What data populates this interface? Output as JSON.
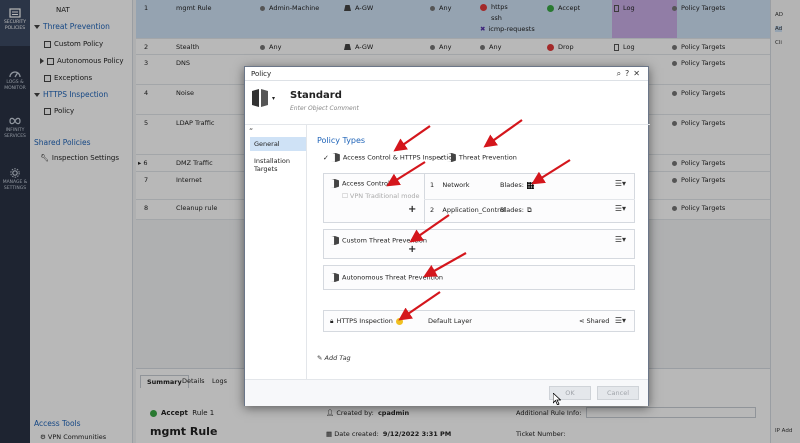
{
  "rail": [
    {
      "label": "SECURITY POLICIES",
      "icon": "security-policies-icon",
      "active": true
    },
    {
      "label": "LOGS & MONITOR",
      "icon": "logs-monitor-icon"
    },
    {
      "label": "INFINITY SERVICES",
      "icon": "infinity-icon"
    },
    {
      "label": "MANAGE & SETTINGS",
      "icon": "manage-settings-icon"
    }
  ],
  "nav": {
    "nat": "NAT",
    "threat_prevention": "Threat Prevention",
    "custom_policy": "Custom Policy",
    "autonomous_policy": "Autonomous Policy",
    "exceptions": "Exceptions",
    "https_inspection": "HTTPS Inspection",
    "policy": "Policy",
    "shared_policies": "Shared Policies",
    "inspection_settings": "Inspection Settings"
  },
  "rules": [
    {
      "no": "1",
      "name": "mgmt Rule",
      "source": "Admin-Machine",
      "dest": "A-GW",
      "vpn": "Any",
      "services": [
        "https",
        "ssh",
        "icmp-requests"
      ],
      "action": "Accept",
      "track": "Log",
      "install": "Policy Targets"
    },
    {
      "no": "2",
      "name": "Stealth",
      "source": "Any",
      "dest": "A-GW",
      "vpn": "Any",
      "services": [
        "Any"
      ],
      "action": "Drop",
      "track": "Log",
      "install": "Policy Targets"
    },
    {
      "no": "3",
      "name": "DNS",
      "source": "",
      "dest": "",
      "vpn": "",
      "services": [],
      "action": "",
      "track": "",
      "install": "Policy Targets"
    },
    {
      "no": "4",
      "name": "Noise",
      "source": "",
      "dest": "",
      "vpn": "",
      "services": [],
      "action": "",
      "track": "",
      "install": "Policy Targets"
    },
    {
      "no": "5",
      "name": "LDAP Traffic",
      "source": "",
      "dest": "",
      "vpn": "",
      "services": [],
      "action": "",
      "track": "",
      "install": "Policy Targets"
    },
    {
      "no": "6",
      "name": "DMZ Traffic",
      "source": "",
      "dest": "",
      "vpn": "",
      "services": [],
      "action": "",
      "track": "",
      "install": "Policy Targets"
    },
    {
      "no": "7",
      "name": "Internet",
      "source": "",
      "dest": "",
      "vpn": "",
      "services": [],
      "action": "",
      "track": "",
      "install": "Policy Targets"
    },
    {
      "no": "8",
      "name": "Cleanup rule",
      "source": "",
      "dest": "",
      "vpn": "",
      "services": [],
      "action": "",
      "track": "",
      "install": "Policy Targets"
    }
  ],
  "right_panel": [
    "AD",
    "Ad",
    "Cli"
  ],
  "bottom": {
    "tabs": [
      "Summary",
      "Details",
      "Logs"
    ],
    "action": "Accept",
    "rule_no": "Rule 1",
    "rule_name": "mgmt Rule",
    "created_by_label": "Created by:",
    "created_by": "cpadmin",
    "date_created_label": "Date created:",
    "date_created": "9/12/2022 3:31 PM",
    "additional_info_label": "Additional Rule Info:",
    "ticket_label": "Ticket Number:",
    "ip_label": "IP Add"
  },
  "access_tools": "Access Tools",
  "vpn_communities": "VPN Communities",
  "dialog": {
    "title": "Policy",
    "name": "Standard",
    "comment_placeholder": "Enter Object Comment",
    "side_items": [
      "General",
      "Installation Targets"
    ],
    "policy_types_label": "Policy Types",
    "access_control_https": "Access Control & HTTPS Inspection",
    "threat_prevention": "Threat Prevention",
    "access_control": "Access Control",
    "vpn_traditional": "VPN Traditional mode",
    "layers": [
      {
        "no": "1",
        "name": "Network",
        "blades": "Blades:"
      },
      {
        "no": "2",
        "name": "Application_Control",
        "blades": "Blades:"
      }
    ],
    "custom_tp": "Custom Threat Prevention",
    "autonomous_tp": "Autonomous Threat Prevention",
    "https_inspection": "HTTPS Inspection",
    "default_layer": "Default Layer",
    "shared": "Shared",
    "add_tag": "Add Tag",
    "ok": "OK",
    "cancel": "Cancel"
  },
  "colors": {
    "accent": "#1e63b8",
    "selected_row": "#cfe2f6",
    "annotation": "#d4161c"
  }
}
